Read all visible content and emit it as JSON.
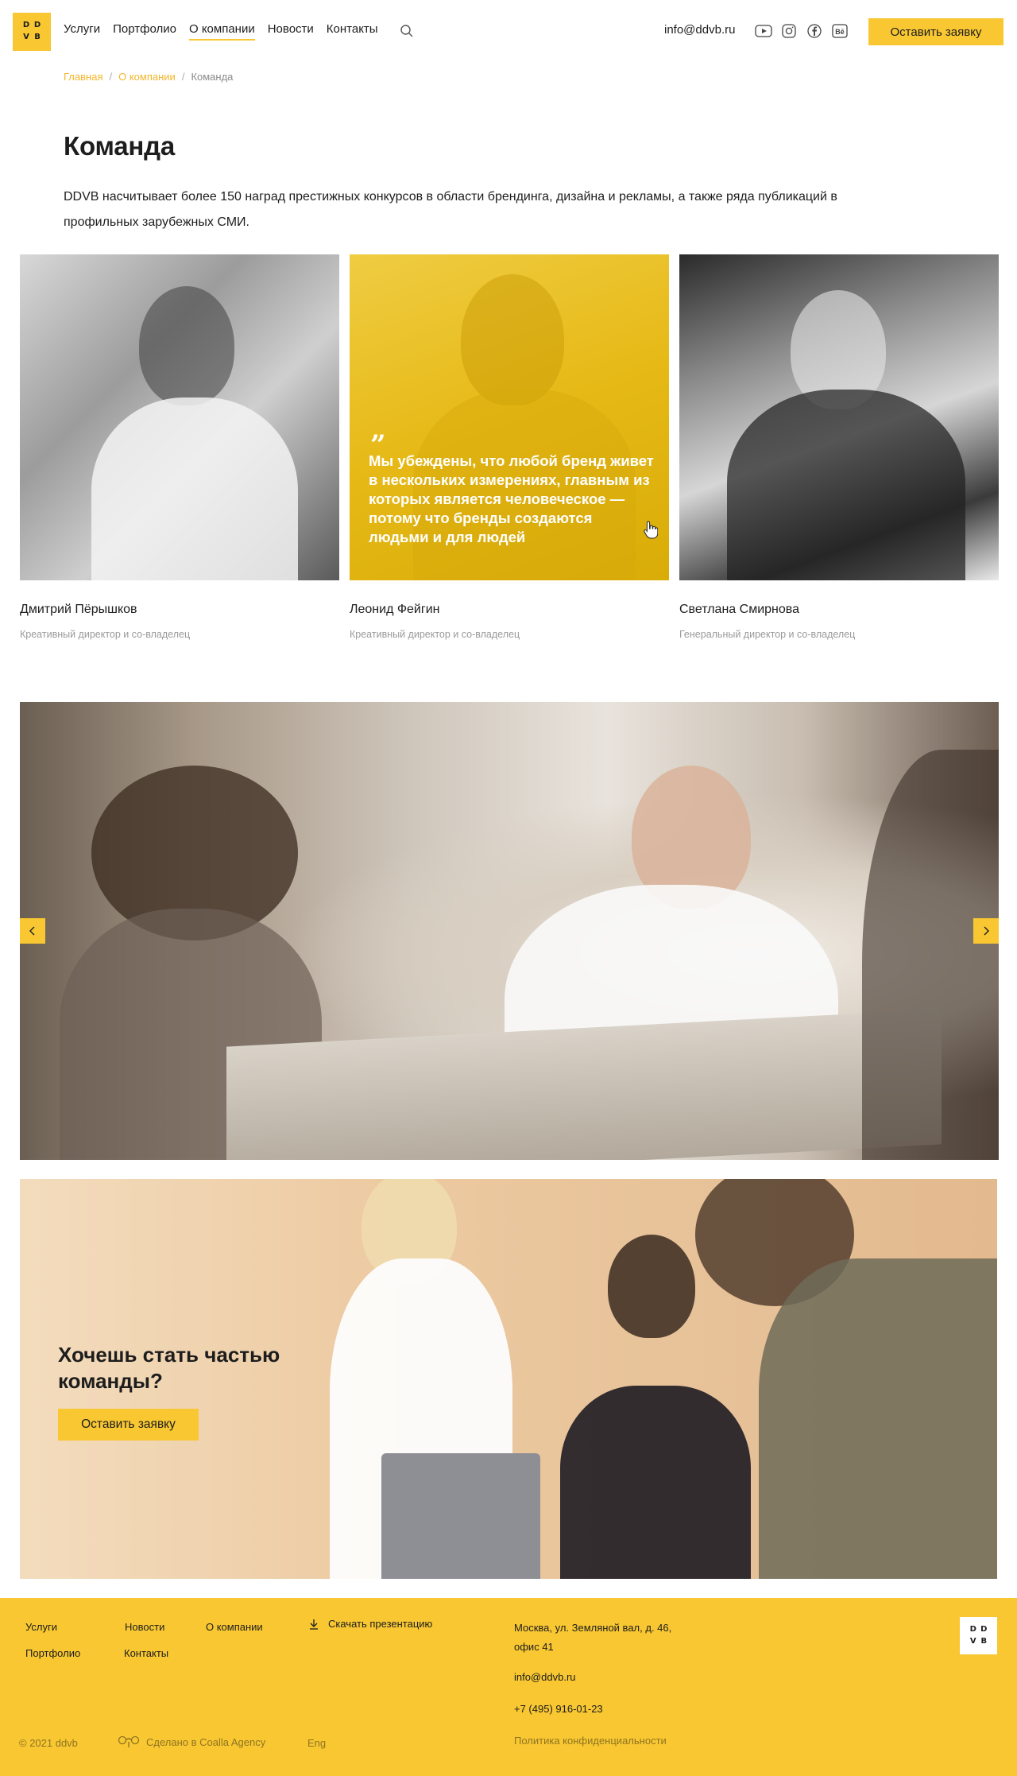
{
  "header": {
    "logo_letters": [
      "D",
      "D",
      "V",
      "B"
    ],
    "nav": [
      "Услуги",
      "Портфолио",
      "О компании",
      "Новости",
      "Контакты"
    ],
    "active_nav": "О компании",
    "email": "info@ddvb.ru",
    "socials": [
      "youtube-icon",
      "instagram-icon",
      "facebook-icon",
      "behance-icon"
    ],
    "social_labels": {
      "behance": "Bē"
    },
    "cta": "Оставить заявку"
  },
  "breadcrumb": {
    "home": "Главная",
    "about": "О компании",
    "current": "Команда"
  },
  "page": {
    "title": "Команда",
    "intro": "DDVB насчитывает более 150 наград престижных конкурсов   в области брендинга, дизайна и рекламы, а также ряда публикаций в профильных зарубежных СМИ."
  },
  "team": [
    {
      "name": "Дмитрий Пёрышков",
      "role": "Креативный директор и со-владелец"
    },
    {
      "name": "Леонид Фейгин",
      "role": "Креативный директор и со-владелец",
      "quote_mark": "”",
      "quote": "Мы убеждены, что любой бренд живет в нескольких измерениях, главным из которых является человеческое — потому что бренды создаются людьми и для людей"
    },
    {
      "name": "Светлана Смирнова",
      "role": "Генеральный директор и со-владелец"
    }
  ],
  "join": {
    "title": "Хочешь стать частью команды?",
    "button": "Оставить заявку"
  },
  "footer": {
    "links": {
      "services": "Услуги",
      "portfolio": "Портфолио",
      "news": "Новости",
      "contacts": "Контакты",
      "about": "О компании"
    },
    "download": "Скачать презентацию",
    "address": "Москва, ул. Земляной вал, д. 46, офис 41",
    "email": "info@ddvb.ru",
    "phone": "+7 (495) 916-01-23",
    "privacy": "Политика конфиденциальности",
    "copyright": "© 2021 ddvb",
    "made_by": "Сделано в Coalla Agency",
    "lang": "Eng"
  },
  "colors": {
    "accent": "#f8c732",
    "link": "#f3b62d"
  }
}
